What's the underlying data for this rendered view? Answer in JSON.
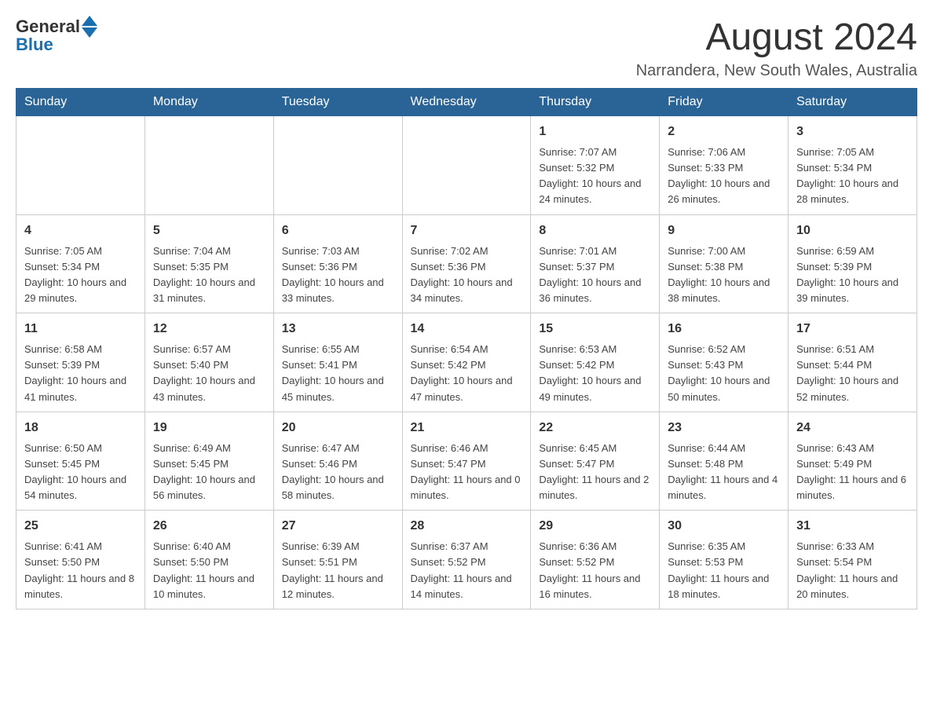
{
  "header": {
    "logo_general": "General",
    "logo_blue": "Blue",
    "month_title": "August 2024",
    "location": "Narrandera, New South Wales, Australia"
  },
  "days_of_week": [
    "Sunday",
    "Monday",
    "Tuesday",
    "Wednesday",
    "Thursday",
    "Friday",
    "Saturday"
  ],
  "weeks": [
    {
      "days": [
        {
          "number": "",
          "info": ""
        },
        {
          "number": "",
          "info": ""
        },
        {
          "number": "",
          "info": ""
        },
        {
          "number": "",
          "info": ""
        },
        {
          "number": "1",
          "info": "Sunrise: 7:07 AM\nSunset: 5:32 PM\nDaylight: 10 hours and 24 minutes."
        },
        {
          "number": "2",
          "info": "Sunrise: 7:06 AM\nSunset: 5:33 PM\nDaylight: 10 hours and 26 minutes."
        },
        {
          "number": "3",
          "info": "Sunrise: 7:05 AM\nSunset: 5:34 PM\nDaylight: 10 hours and 28 minutes."
        }
      ]
    },
    {
      "days": [
        {
          "number": "4",
          "info": "Sunrise: 7:05 AM\nSunset: 5:34 PM\nDaylight: 10 hours and 29 minutes."
        },
        {
          "number": "5",
          "info": "Sunrise: 7:04 AM\nSunset: 5:35 PM\nDaylight: 10 hours and 31 minutes."
        },
        {
          "number": "6",
          "info": "Sunrise: 7:03 AM\nSunset: 5:36 PM\nDaylight: 10 hours and 33 minutes."
        },
        {
          "number": "7",
          "info": "Sunrise: 7:02 AM\nSunset: 5:36 PM\nDaylight: 10 hours and 34 minutes."
        },
        {
          "number": "8",
          "info": "Sunrise: 7:01 AM\nSunset: 5:37 PM\nDaylight: 10 hours and 36 minutes."
        },
        {
          "number": "9",
          "info": "Sunrise: 7:00 AM\nSunset: 5:38 PM\nDaylight: 10 hours and 38 minutes."
        },
        {
          "number": "10",
          "info": "Sunrise: 6:59 AM\nSunset: 5:39 PM\nDaylight: 10 hours and 39 minutes."
        }
      ]
    },
    {
      "days": [
        {
          "number": "11",
          "info": "Sunrise: 6:58 AM\nSunset: 5:39 PM\nDaylight: 10 hours and 41 minutes."
        },
        {
          "number": "12",
          "info": "Sunrise: 6:57 AM\nSunset: 5:40 PM\nDaylight: 10 hours and 43 minutes."
        },
        {
          "number": "13",
          "info": "Sunrise: 6:55 AM\nSunset: 5:41 PM\nDaylight: 10 hours and 45 minutes."
        },
        {
          "number": "14",
          "info": "Sunrise: 6:54 AM\nSunset: 5:42 PM\nDaylight: 10 hours and 47 minutes."
        },
        {
          "number": "15",
          "info": "Sunrise: 6:53 AM\nSunset: 5:42 PM\nDaylight: 10 hours and 49 minutes."
        },
        {
          "number": "16",
          "info": "Sunrise: 6:52 AM\nSunset: 5:43 PM\nDaylight: 10 hours and 50 minutes."
        },
        {
          "number": "17",
          "info": "Sunrise: 6:51 AM\nSunset: 5:44 PM\nDaylight: 10 hours and 52 minutes."
        }
      ]
    },
    {
      "days": [
        {
          "number": "18",
          "info": "Sunrise: 6:50 AM\nSunset: 5:45 PM\nDaylight: 10 hours and 54 minutes."
        },
        {
          "number": "19",
          "info": "Sunrise: 6:49 AM\nSunset: 5:45 PM\nDaylight: 10 hours and 56 minutes."
        },
        {
          "number": "20",
          "info": "Sunrise: 6:47 AM\nSunset: 5:46 PM\nDaylight: 10 hours and 58 minutes."
        },
        {
          "number": "21",
          "info": "Sunrise: 6:46 AM\nSunset: 5:47 PM\nDaylight: 11 hours and 0 minutes."
        },
        {
          "number": "22",
          "info": "Sunrise: 6:45 AM\nSunset: 5:47 PM\nDaylight: 11 hours and 2 minutes."
        },
        {
          "number": "23",
          "info": "Sunrise: 6:44 AM\nSunset: 5:48 PM\nDaylight: 11 hours and 4 minutes."
        },
        {
          "number": "24",
          "info": "Sunrise: 6:43 AM\nSunset: 5:49 PM\nDaylight: 11 hours and 6 minutes."
        }
      ]
    },
    {
      "days": [
        {
          "number": "25",
          "info": "Sunrise: 6:41 AM\nSunset: 5:50 PM\nDaylight: 11 hours and 8 minutes."
        },
        {
          "number": "26",
          "info": "Sunrise: 6:40 AM\nSunset: 5:50 PM\nDaylight: 11 hours and 10 minutes."
        },
        {
          "number": "27",
          "info": "Sunrise: 6:39 AM\nSunset: 5:51 PM\nDaylight: 11 hours and 12 minutes."
        },
        {
          "number": "28",
          "info": "Sunrise: 6:37 AM\nSunset: 5:52 PM\nDaylight: 11 hours and 14 minutes."
        },
        {
          "number": "29",
          "info": "Sunrise: 6:36 AM\nSunset: 5:52 PM\nDaylight: 11 hours and 16 minutes."
        },
        {
          "number": "30",
          "info": "Sunrise: 6:35 AM\nSunset: 5:53 PM\nDaylight: 11 hours and 18 minutes."
        },
        {
          "number": "31",
          "info": "Sunrise: 6:33 AM\nSunset: 5:54 PM\nDaylight: 11 hours and 20 minutes."
        }
      ]
    }
  ]
}
